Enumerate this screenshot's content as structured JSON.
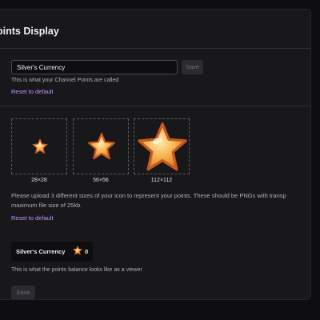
{
  "header": {
    "title": "oints Display"
  },
  "name_field": {
    "value": "Silver's Currency",
    "save_label": "Save",
    "helper": "This is what your Channel Points are called",
    "reset_label": "Reset to default"
  },
  "icon_upload": {
    "sizes": [
      "28×28",
      "56×56",
      "112×112"
    ],
    "icon": "star-icon",
    "description_line1": "Please upload 3 different sizes of your icon to represent your points. These should be PNGs with transp",
    "description_line2": "maximum file size of 25kb.",
    "reset_label": "Reset to default"
  },
  "balance_preview": {
    "name": "Silver's Currency",
    "value": "0",
    "helper": "This is what the points balance looks like as a viewer"
  },
  "footer": {
    "save_label": "Save"
  },
  "colors": {
    "background": "#0e0e10",
    "card": "#18181b",
    "accent_link": "#bf94ff",
    "star_fill": "#f5a742",
    "star_outline": "#c8581e"
  }
}
